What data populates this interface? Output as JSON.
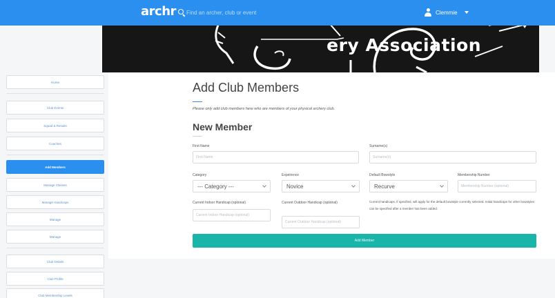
{
  "nav": {
    "logo": "archr",
    "search_placeholder": "Find an archer, club or event",
    "user_name": "Clemmie",
    "icons": {
      "search": "search-icon",
      "user": "user-icon",
      "caret": "caret-down-icon"
    },
    "color": "#2b8ff0"
  },
  "banner": {
    "title_visible": "ery Association"
  },
  "sidebar": {
    "items": [
      {
        "label": "Home"
      },
      {
        "label": "Club Events"
      },
      {
        "label": "Squad & Results"
      },
      {
        "label": "Coaches"
      },
      {
        "label": "Add Members",
        "active": true
      },
      {
        "label": "Manage Classes"
      },
      {
        "label": "Manage Handicaps"
      },
      {
        "label": "Manage"
      },
      {
        "label": "Manage"
      },
      {
        "label": "Club Details"
      },
      {
        "label": "Club Profile"
      },
      {
        "label": "Club Membership Levels"
      }
    ]
  },
  "main": {
    "title": "Add Club Members",
    "intro": "Please only add club members here who are members of your physical archery club.",
    "section_title": "New Member",
    "form": {
      "first_name": {
        "label": "First Name",
        "placeholder": "First Name"
      },
      "surname": {
        "label": "Surname(s)",
        "placeholder": "Surname(s)"
      },
      "category": {
        "label": "Category",
        "value": "--- Category ---"
      },
      "experience": {
        "label": "Experience",
        "value": "Novice"
      },
      "bowstyle": {
        "label": "Default Bowstyle",
        "value": "Recurve"
      },
      "membership": {
        "label": "Membership Number",
        "placeholder": "Membership Number (optional)"
      },
      "indoor_handicap": {
        "label": "Current Indoor Handicap (optional)",
        "placeholder": "Current Indoor Handicap (optional)"
      },
      "outdoor_handicap": {
        "label": "Current Outdoor Handicap (optional)",
        "placeholder": "Current Outdoor Handicap (optional)"
      },
      "note": "Current handicaps, if specified, will apply for the default bowstyle currently selected. Initial handicaps for other bowstyles can be specified after a member has been added.",
      "submit_label": "Add Member",
      "submit_color": "#1ab5a8"
    }
  }
}
